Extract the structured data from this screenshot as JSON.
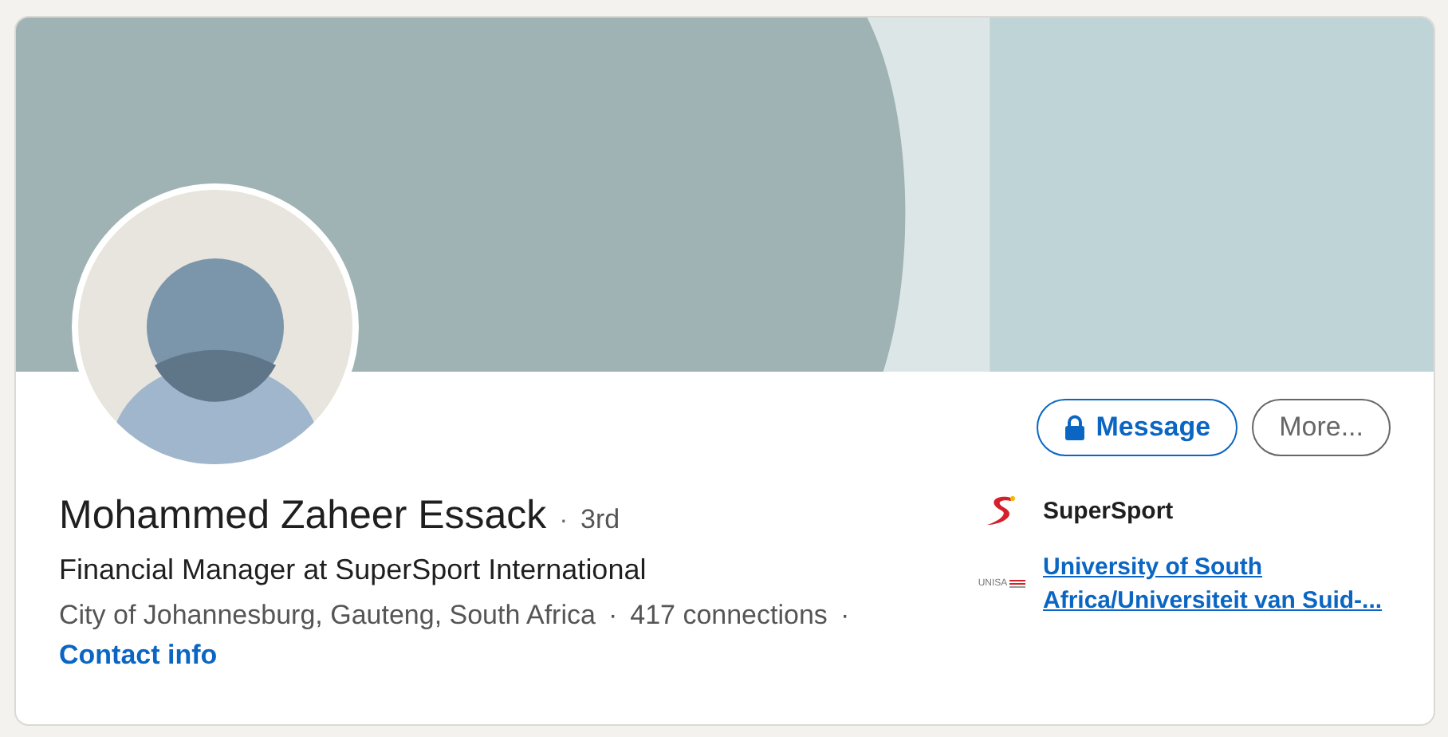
{
  "profile": {
    "name": "Mohammed Zaheer Essack",
    "degree": "3rd",
    "headline": "Financial Manager at SuperSport International",
    "location": "City of Johannesburg, Gauteng, South Africa",
    "connections": "417 connections",
    "contact_link": "Contact info",
    "separator": "·"
  },
  "buttons": [
    {
      "label": "Message",
      "kind": "primary"
    },
    {
      "label": "More...",
      "kind": "secondary"
    }
  ],
  "affiliations": [
    {
      "kind": "company",
      "name": "SuperSport"
    },
    {
      "kind": "school",
      "name": "University of South Africa/Universiteit van Suid-...",
      "logo_text": "UNISA"
    }
  ]
}
